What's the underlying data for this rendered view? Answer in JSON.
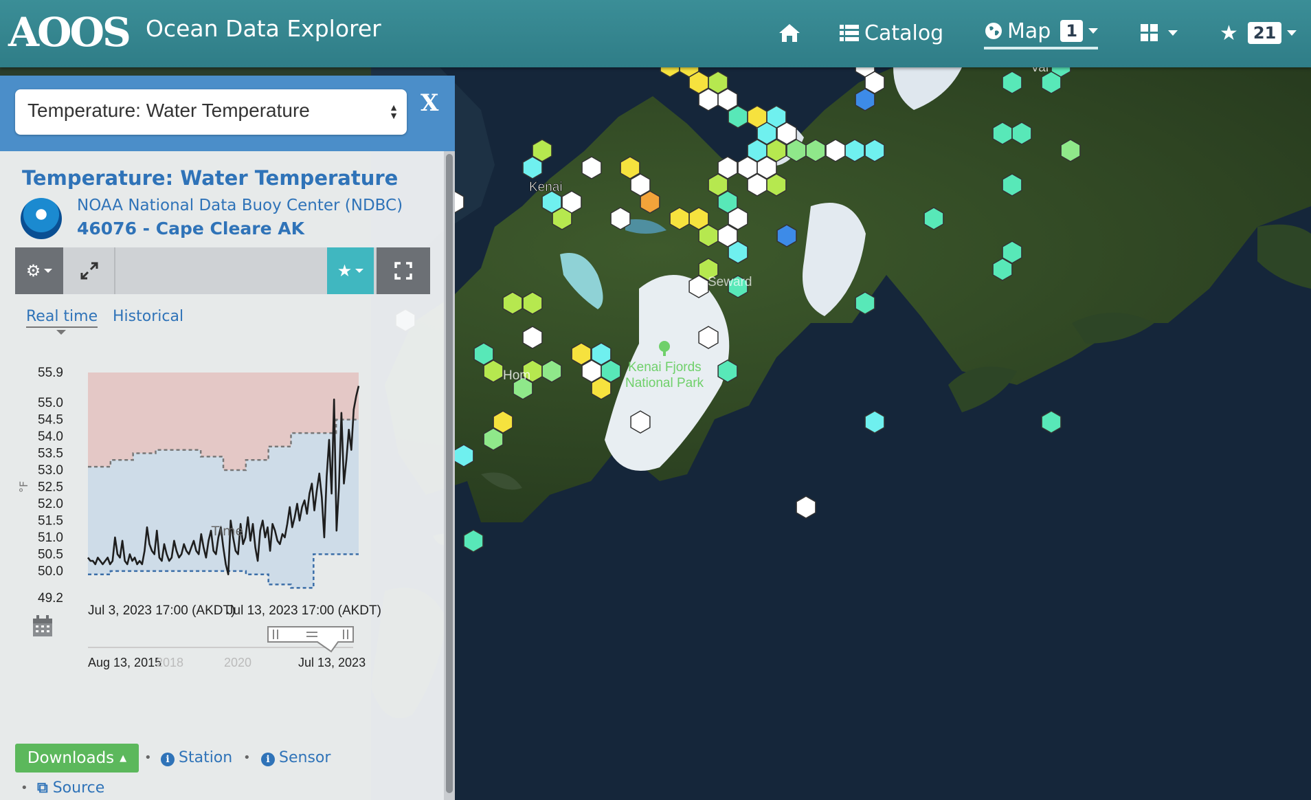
{
  "header": {
    "logo": "AOOS",
    "title": "Ocean Data Explorer",
    "nav": {
      "catalog": "Catalog",
      "map": "Map",
      "map_count": "1",
      "favorites_count": "21"
    }
  },
  "map": {
    "labels": {
      "kenai": "Kenai",
      "park_line1": "Kenai Fjords",
      "park_line2": "National Park",
      "seward": "Seward",
      "val": "Val",
      "hom": "Hom"
    },
    "colors": {
      "white": "#ffffff",
      "yellow": "#f6e23e",
      "lime": "#b6e84f",
      "green": "#8fe88a",
      "mint": "#58e8b8",
      "cyan": "#6ff0ef",
      "blue": "#3d8be8",
      "orange": "#f2a33a"
    },
    "stations": [
      {
        "x": 975,
        "y": 96,
        "c": "yellow"
      },
      {
        "x": 1003,
        "y": 96,
        "c": "yellow"
      },
      {
        "x": 1017,
        "y": 120,
        "c": "yellow"
      },
      {
        "x": 1045,
        "y": 120,
        "c": "lime"
      },
      {
        "x": 1031,
        "y": 145,
        "c": "white"
      },
      {
        "x": 1059,
        "y": 145,
        "c": "white"
      },
      {
        "x": 1074,
        "y": 170,
        "c": "mint"
      },
      {
        "x": 1102,
        "y": 170,
        "c": "yellow"
      },
      {
        "x": 1130,
        "y": 170,
        "c": "cyan"
      },
      {
        "x": 1116,
        "y": 194,
        "c": "cyan"
      },
      {
        "x": 1145,
        "y": 194,
        "c": "white"
      },
      {
        "x": 1102,
        "y": 219,
        "c": "cyan"
      },
      {
        "x": 1130,
        "y": 219,
        "c": "lime"
      },
      {
        "x": 1159,
        "y": 219,
        "c": "green"
      },
      {
        "x": 1187,
        "y": 219,
        "c": "green"
      },
      {
        "x": 1216,
        "y": 219,
        "c": "white"
      },
      {
        "x": 1244,
        "y": 219,
        "c": "cyan"
      },
      {
        "x": 1273,
        "y": 219,
        "c": "cyan"
      },
      {
        "x": 1059,
        "y": 244,
        "c": "white"
      },
      {
        "x": 1088,
        "y": 244,
        "c": "white"
      },
      {
        "x": 1116,
        "y": 244,
        "c": "white"
      },
      {
        "x": 1045,
        "y": 269,
        "c": "lime"
      },
      {
        "x": 1102,
        "y": 269,
        "c": "white"
      },
      {
        "x": 1130,
        "y": 269,
        "c": "lime"
      },
      {
        "x": 1059,
        "y": 294,
        "c": "mint"
      },
      {
        "x": 1074,
        "y": 318,
        "c": "white"
      },
      {
        "x": 1031,
        "y": 343,
        "c": "lime"
      },
      {
        "x": 1059,
        "y": 343,
        "c": "white"
      },
      {
        "x": 1074,
        "y": 367,
        "c": "cyan"
      },
      {
        "x": 1031,
        "y": 392,
        "c": "lime"
      },
      {
        "x": 1017,
        "y": 417,
        "c": "white"
      },
      {
        "x": 1074,
        "y": 417,
        "c": "mint"
      },
      {
        "x": 1259,
        "y": 96,
        "c": "white"
      },
      {
        "x": 1273,
        "y": 120,
        "c": "white"
      },
      {
        "x": 1259,
        "y": 145,
        "c": "blue"
      },
      {
        "x": 1145,
        "y": 343,
        "c": "blue"
      },
      {
        "x": 789,
        "y": 219,
        "c": "lime"
      },
      {
        "x": 775,
        "y": 244,
        "c": "cyan"
      },
      {
        "x": 861,
        "y": 244,
        "c": "white"
      },
      {
        "x": 917,
        "y": 244,
        "c": "yellow"
      },
      {
        "x": 932,
        "y": 269,
        "c": "white"
      },
      {
        "x": 946,
        "y": 294,
        "c": "orange"
      },
      {
        "x": 803,
        "y": 294,
        "c": "cyan"
      },
      {
        "x": 832,
        "y": 294,
        "c": "white"
      },
      {
        "x": 818,
        "y": 318,
        "c": "lime"
      },
      {
        "x": 903,
        "y": 318,
        "c": "white"
      },
      {
        "x": 989,
        "y": 318,
        "c": "yellow"
      },
      {
        "x": 1017,
        "y": 318,
        "c": "yellow"
      },
      {
        "x": 661,
        "y": 294,
        "c": "white"
      },
      {
        "x": 590,
        "y": 466,
        "c": "white"
      },
      {
        "x": 746,
        "y": 441,
        "c": "lime"
      },
      {
        "x": 775,
        "y": 441,
        "c": "lime"
      },
      {
        "x": 775,
        "y": 491,
        "c": "white"
      },
      {
        "x": 704,
        "y": 515,
        "c": "mint"
      },
      {
        "x": 718,
        "y": 540,
        "c": "lime"
      },
      {
        "x": 775,
        "y": 540,
        "c": "lime"
      },
      {
        "x": 803,
        "y": 540,
        "c": "green"
      },
      {
        "x": 761,
        "y": 565,
        "c": "green"
      },
      {
        "x": 846,
        "y": 515,
        "c": "yellow"
      },
      {
        "x": 875,
        "y": 515,
        "c": "cyan"
      },
      {
        "x": 861,
        "y": 540,
        "c": "white"
      },
      {
        "x": 889,
        "y": 540,
        "c": "mint"
      },
      {
        "x": 875,
        "y": 565,
        "c": "yellow"
      },
      {
        "x": 732,
        "y": 614,
        "c": "yellow"
      },
      {
        "x": 718,
        "y": 639,
        "c": "green"
      },
      {
        "x": 675,
        "y": 663,
        "c": "cyan"
      },
      {
        "x": 689,
        "y": 787,
        "c": "mint"
      },
      {
        "x": 932,
        "y": 614,
        "c": "white"
      },
      {
        "x": 1031,
        "y": 491,
        "c": "white"
      },
      {
        "x": 1059,
        "y": 540,
        "c": "mint"
      },
      {
        "x": 1259,
        "y": 441,
        "c": "mint"
      },
      {
        "x": 1273,
        "y": 614,
        "c": "cyan"
      },
      {
        "x": 1173,
        "y": 738,
        "c": "white"
      },
      {
        "x": 1359,
        "y": 318,
        "c": "mint"
      },
      {
        "x": 1473,
        "y": 269,
        "c": "mint"
      },
      {
        "x": 1459,
        "y": 194,
        "c": "mint"
      },
      {
        "x": 1487,
        "y": 194,
        "c": "mint"
      },
      {
        "x": 1473,
        "y": 120,
        "c": "mint"
      },
      {
        "x": 1530,
        "y": 120,
        "c": "mint"
      },
      {
        "x": 1544,
        "y": 96,
        "c": "mint"
      },
      {
        "x": 1473,
        "y": 367,
        "c": "mint"
      },
      {
        "x": 1459,
        "y": 392,
        "c": "mint"
      },
      {
        "x": 1530,
        "y": 614,
        "c": "mint"
      },
      {
        "x": 1558,
        "y": 219,
        "c": "green"
      }
    ]
  },
  "panel": {
    "parameter_select": "Temperature: Water Temperature",
    "close_label": "X",
    "title": "Temperature: Water Temperature",
    "provider": "NOAA National Data Buoy Center (NDBC)",
    "station": "46076 - Cape Cleare AK",
    "tabs": {
      "realtime": "Real time",
      "historical": "Historical"
    },
    "downloads": "Downloads",
    "station_link": "Station",
    "sensor_link": "Sensor",
    "source_link": "Source",
    "time_label": "Time"
  },
  "chart_data": {
    "type": "line",
    "ylabel": "°F",
    "xlabel": "Time",
    "ylim": [
      49.2,
      55.9
    ],
    "yticks": [
      "55.9",
      "55.0",
      "54.5",
      "54.0",
      "53.5",
      "53.0",
      "52.5",
      "52.0",
      "51.5",
      "51.0",
      "50.5",
      "50.0",
      "49.2"
    ],
    "x_ticks": [
      "Jul 3, 2023 17:00 (AKDT)",
      "Jul 13, 2023 17:00 (AKDT)"
    ],
    "range_selector": {
      "start": "Aug 13, 2015",
      "mid_ticks": [
        "2018",
        "2020"
      ],
      "end": "Jul 13, 2023"
    },
    "series": [
      {
        "values": [
          50.4,
          50.3,
          50.3,
          50.2,
          50.4,
          50.3,
          50.2,
          50.3,
          50.4,
          50.2,
          50.3,
          51.0,
          50.5,
          50.4,
          50.9,
          50.3,
          50.2,
          50.5,
          50.3,
          50.4,
          50.2,
          50.3,
          50.2,
          50.6,
          51.3,
          50.8,
          50.6,
          50.5,
          51.2,
          50.4,
          50.3,
          50.8,
          50.5,
          50.3,
          50.4,
          50.9,
          50.6,
          50.4,
          50.5,
          50.8,
          50.6,
          50.5,
          50.7,
          50.9,
          50.6,
          50.5,
          51.1,
          50.7,
          50.4,
          50.9,
          51.2,
          50.6,
          50.5,
          51.0,
          51.3,
          50.7,
          50.2,
          49.9,
          51.5,
          51.0,
          50.6,
          50.5,
          51.4,
          50.8,
          51.0,
          51.6,
          50.9,
          51.4,
          50.7,
          50.3,
          51.2,
          51.5,
          51.0,
          51.3,
          50.6,
          51.4,
          51.2,
          50.9,
          50.8,
          51.1,
          51.0,
          51.4,
          51.9,
          51.3,
          51.6,
          52.0,
          51.5,
          51.9,
          52.1,
          51.7,
          52.3,
          52.6,
          51.8,
          52.4,
          52.9,
          52.2,
          51.0,
          52.8,
          53.9,
          52.3,
          55.1,
          51.2,
          52.5,
          54.7,
          52.6,
          53.3,
          54.2,
          53.6,
          54.8,
          55.2,
          55.5
        ]
      }
    ],
    "band_upper": [
      55.9,
      55.9,
      55.1,
      55.9,
      55.9
    ],
    "climatology_max": [
      53.1,
      53.3,
      53.5,
      53.6,
      53.6,
      53.4,
      53.0,
      53.3,
      53.7,
      54.1,
      54.1,
      54.5
    ],
    "climatology_min": [
      49.9,
      50.0,
      50.0,
      50.0,
      50.0,
      50.0,
      50.0,
      49.9,
      49.6,
      49.5,
      50.5,
      50.5
    ]
  }
}
